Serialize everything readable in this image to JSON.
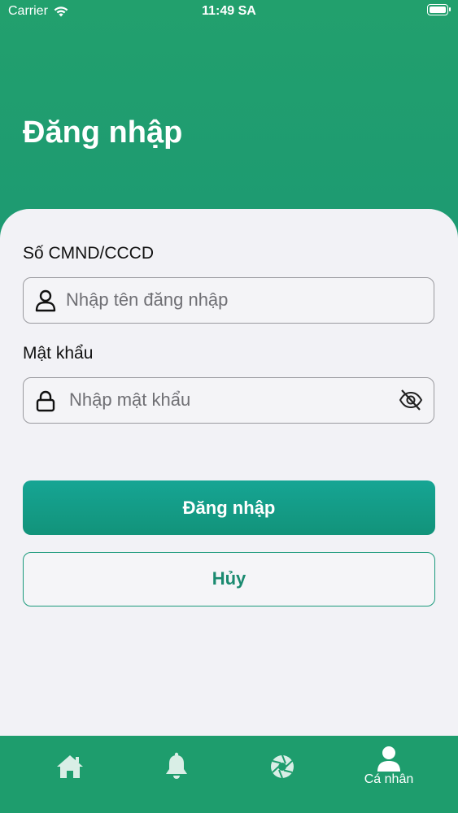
{
  "status_bar": {
    "carrier": "Carrier",
    "time": "11:49 SA"
  },
  "header": {
    "title": "Đăng nhập"
  },
  "form": {
    "id_label": "Số CMND/CCCD",
    "id_placeholder": "Nhập tên đăng nhập",
    "password_label": "Mật khẩu",
    "password_placeholder": "Nhập mật khẩu"
  },
  "buttons": {
    "login": "Đăng nhập",
    "cancel": "Hủy"
  },
  "tabbar": {
    "items": [
      {
        "icon": "home-icon",
        "label": ""
      },
      {
        "icon": "bell-icon",
        "label": ""
      },
      {
        "icon": "aperture-icon",
        "label": ""
      },
      {
        "icon": "user-icon",
        "label": "Cá nhân"
      }
    ]
  },
  "colors": {
    "brand_green": "#1e9d6d",
    "button_green": "#16a594",
    "card_bg": "#f2f2f6"
  }
}
